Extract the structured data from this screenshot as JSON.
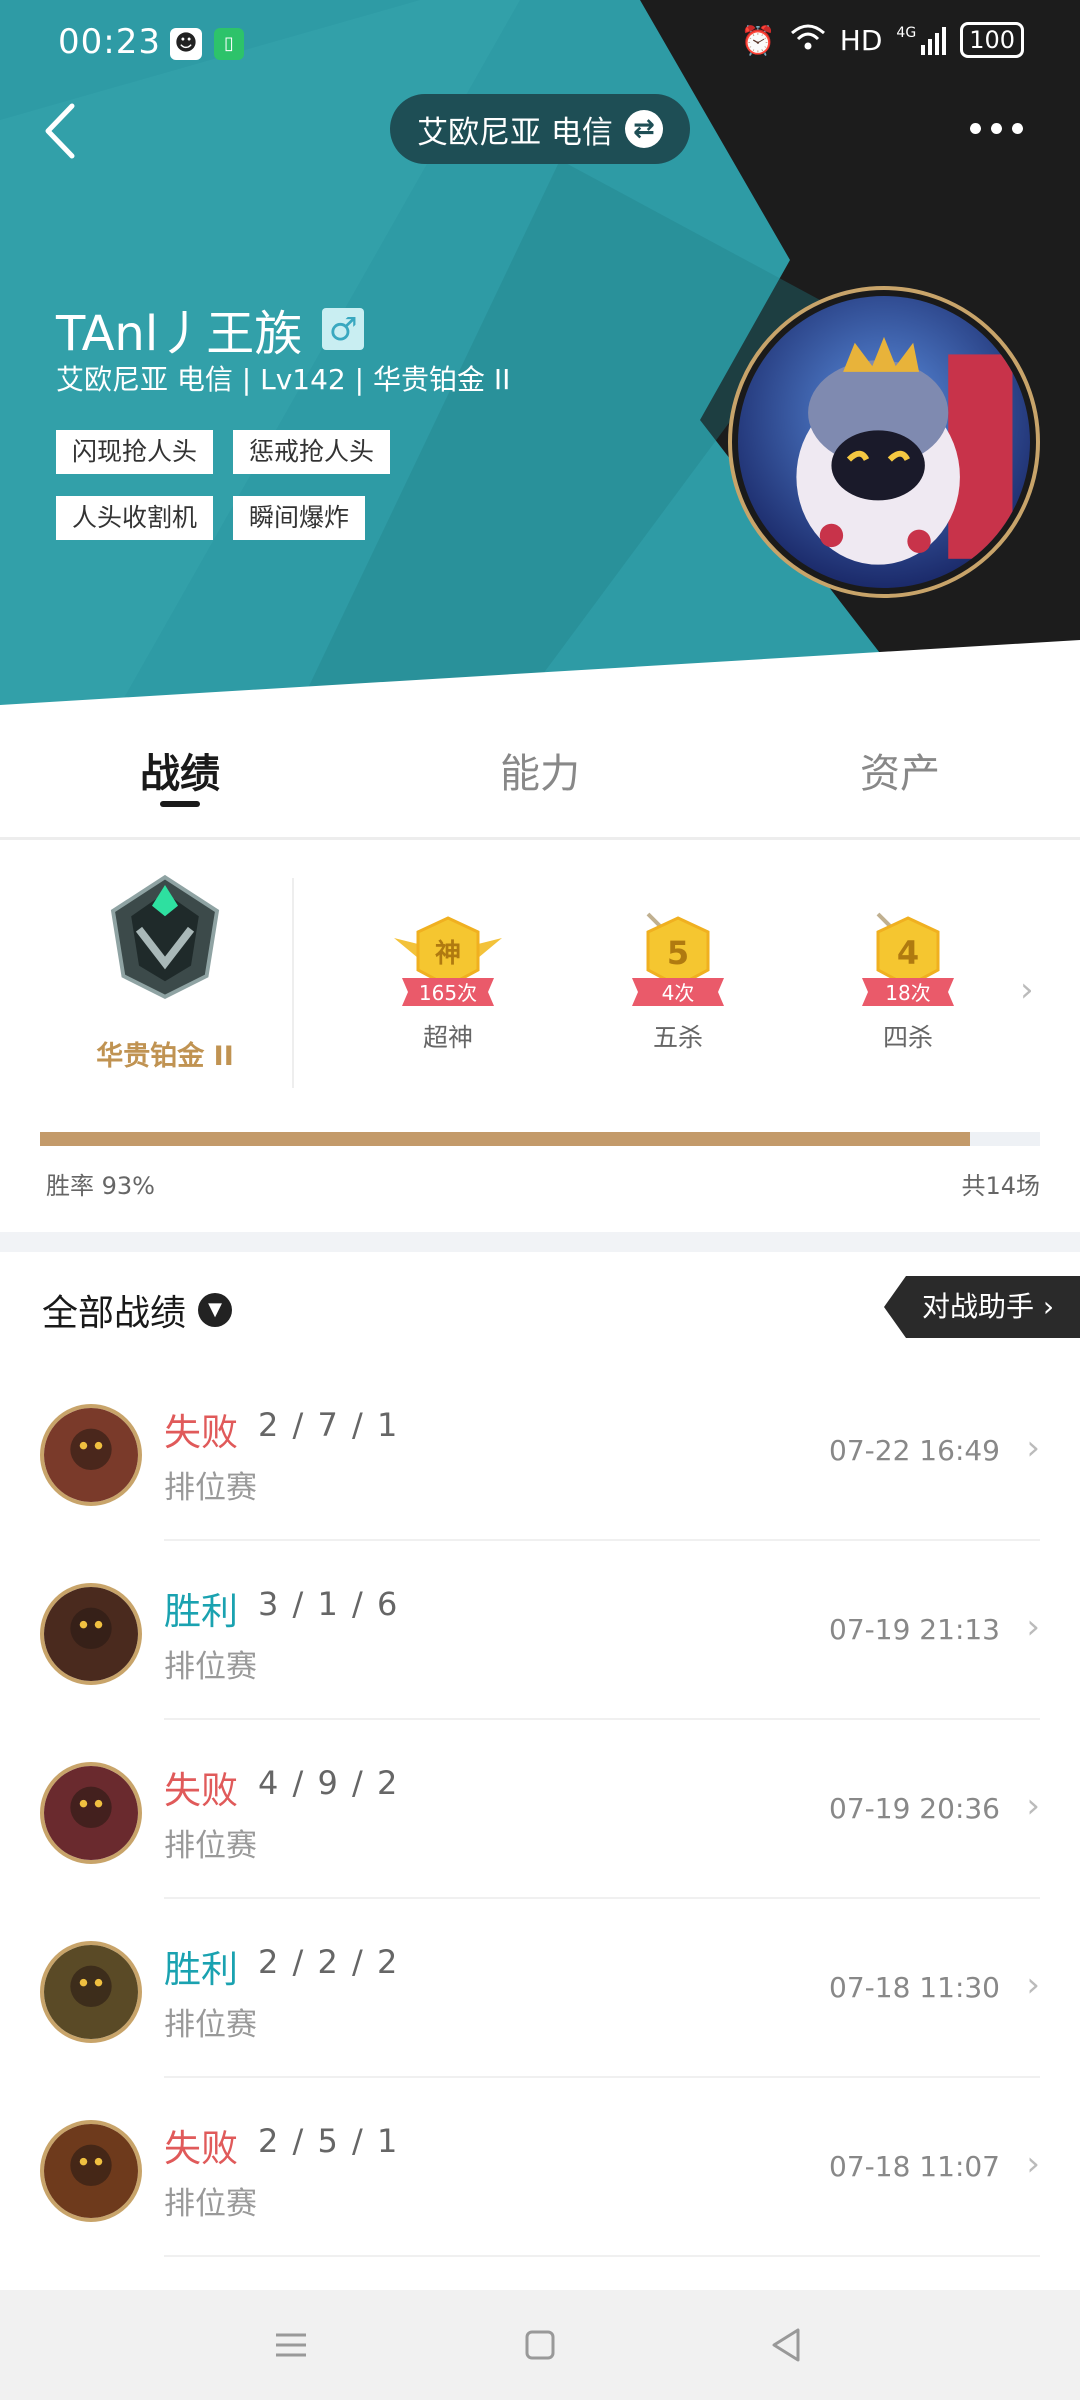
{
  "status_bar": {
    "time": "00:23",
    "network": "HD",
    "signal": "4G",
    "battery": "100"
  },
  "header": {
    "server": "艾欧尼亚 电信",
    "player_name": "TAnl丿王族",
    "gender_symbol": "♂",
    "subtitle": "艾欧尼亚 电信 | Lv142 | 华贵铂金 II",
    "tags": [
      "闪现抢人头",
      "惩戒抢人头",
      "人头收割机",
      "瞬间爆炸"
    ],
    "colors": {
      "teal": "#2e9ba5",
      "dark": "#1c1c1c",
      "gold": "#c8a46a"
    }
  },
  "tabs": [
    {
      "label": "战绩",
      "active": true
    },
    {
      "label": "能力",
      "active": false
    },
    {
      "label": "资产",
      "active": false
    }
  ],
  "stats": {
    "rank": "华贵铂金 II",
    "badges": [
      {
        "glyph": "神",
        "count": "165次",
        "label": "超神"
      },
      {
        "glyph": "5",
        "count": "4次",
        "label": "五杀"
      },
      {
        "glyph": "4",
        "count": "18次",
        "label": "四杀"
      }
    ],
    "win_rate_text": "胜率  93%",
    "win_rate": 0.93,
    "total_text": "共14场"
  },
  "matches_section": {
    "title": "全部战绩",
    "assistant": "对战助手"
  },
  "matches": [
    {
      "result": "失败",
      "outcome": "lose",
      "kda": "2 / 7 / 1",
      "mode": "排位赛",
      "time": "07-22 16:49",
      "hero_color": "#7a3a2a"
    },
    {
      "result": "胜利",
      "outcome": "win",
      "kda": "3 / 1 / 6",
      "mode": "排位赛",
      "time": "07-19 21:13",
      "hero_color": "#4a2a1e"
    },
    {
      "result": "失败",
      "outcome": "lose",
      "kda": "4 / 9 / 2",
      "mode": "排位赛",
      "time": "07-19 20:36",
      "hero_color": "#6a2a2e"
    },
    {
      "result": "胜利",
      "outcome": "win",
      "kda": "2 / 2 / 2",
      "mode": "排位赛",
      "time": "07-18 11:30",
      "hero_color": "#5a4a26"
    },
    {
      "result": "失败",
      "outcome": "lose",
      "kda": "2 / 5 / 1",
      "mode": "排位赛",
      "time": "07-18 11:07",
      "hero_color": "#6e3a1c"
    }
  ]
}
